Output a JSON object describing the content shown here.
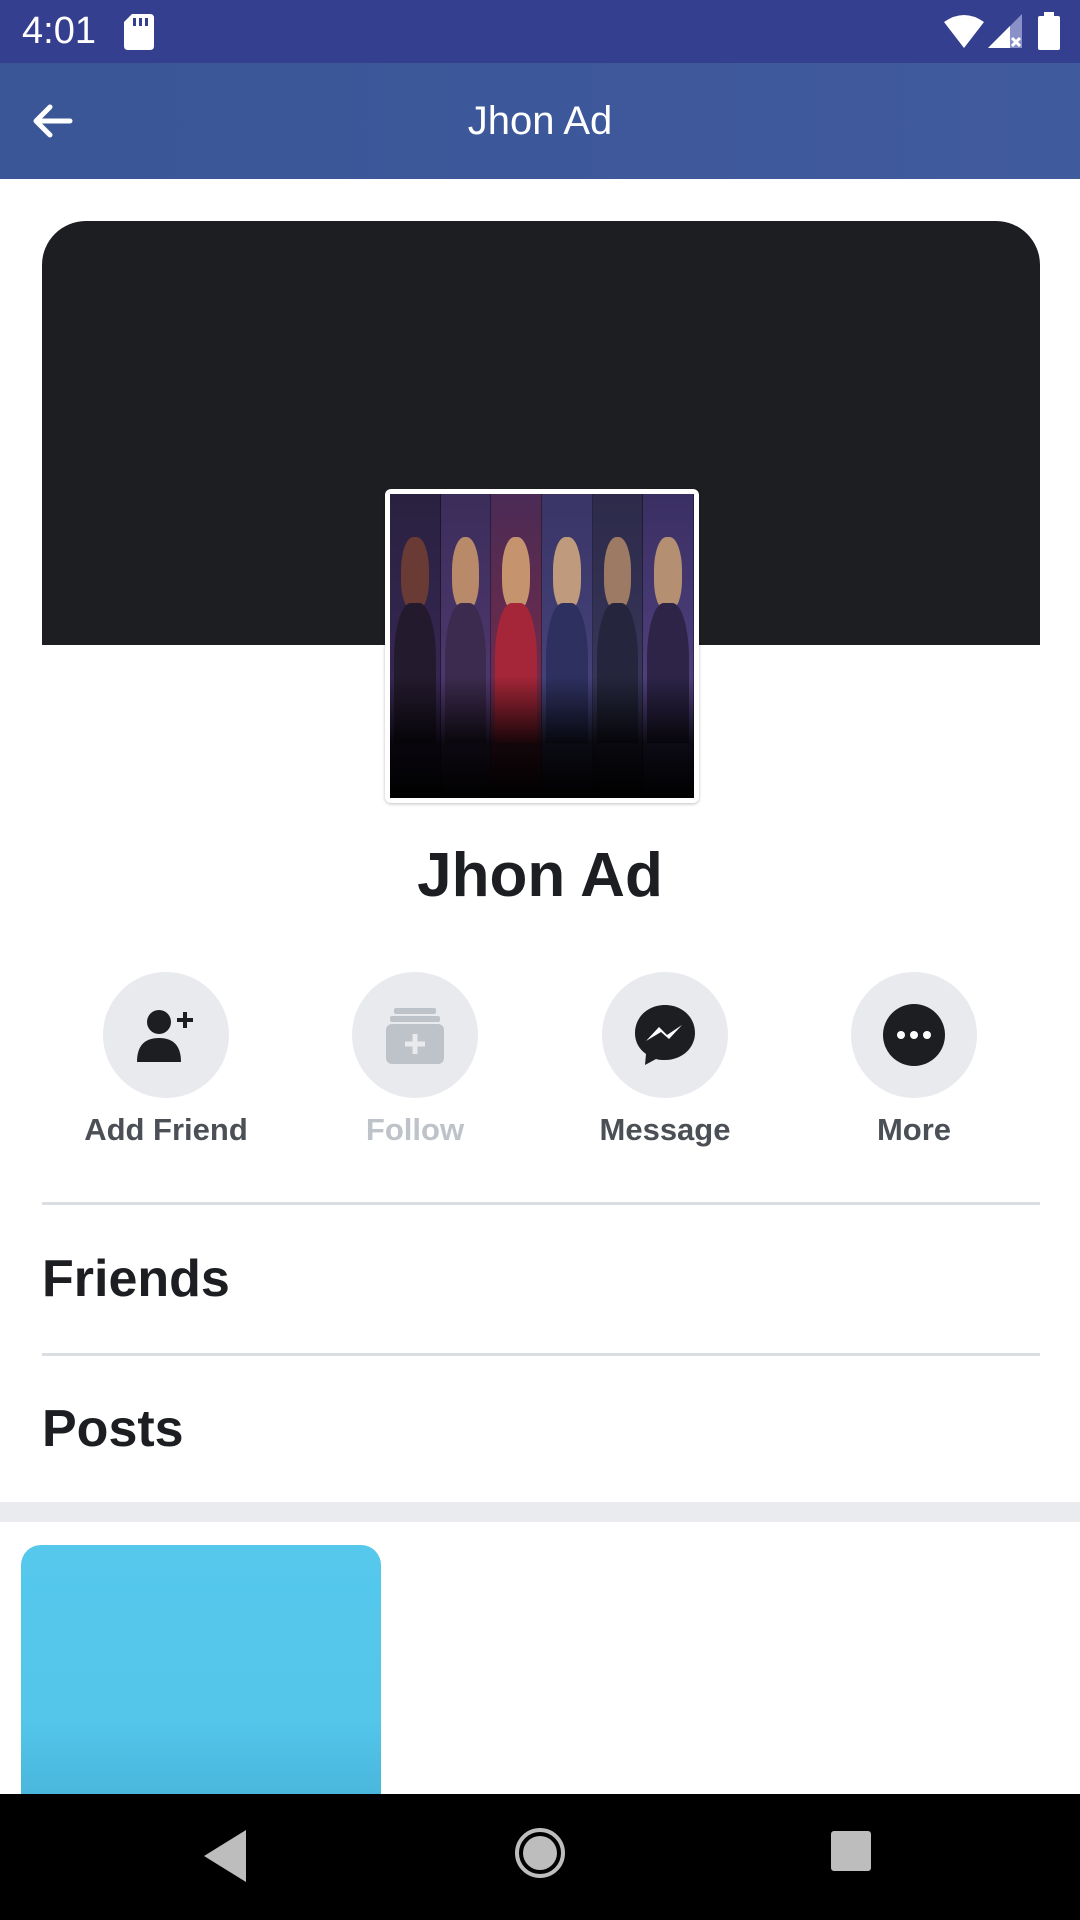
{
  "status_bar": {
    "time": "4:01",
    "icons": [
      "sd-card-icon",
      "wifi-icon",
      "signal-icon",
      "battery-icon"
    ]
  },
  "app_bar": {
    "title": "Jhon Ad",
    "back_icon": "arrow-left-icon"
  },
  "profile": {
    "name": "Jhon Ad"
  },
  "actions": [
    {
      "label": "Add Friend",
      "icon": "add-friend-icon",
      "enabled": true
    },
    {
      "label": "Follow",
      "icon": "follow-icon",
      "enabled": false
    },
    {
      "label": "Message",
      "icon": "messenger-icon",
      "enabled": true
    },
    {
      "label": "More",
      "icon": "more-icon",
      "enabled": true
    }
  ],
  "sections": {
    "friends": "Friends",
    "posts": "Posts"
  },
  "colors": {
    "status_bar": "#353f8f",
    "app_bar": "#3b5998",
    "cover": "#1d1e22",
    "post_card": "#55c8ec"
  },
  "nav_bar": {
    "icons": [
      "nav-back-icon",
      "nav-home-icon",
      "nav-recents-icon"
    ]
  }
}
